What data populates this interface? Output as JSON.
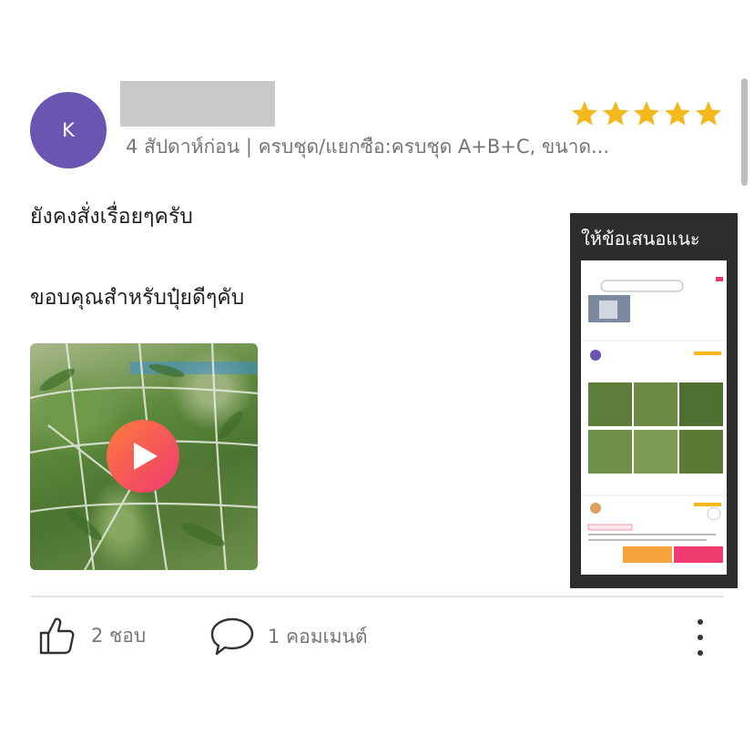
{
  "review": {
    "avatar_initial": "K",
    "rating": 5,
    "meta": "4 สัปดาห์ก่อน | ครบชุด/แยกซือ:ครบชุด A+B+C, ขนาด...",
    "lines": [
      "ยังคงสั่งเรื่อยๆครับ",
      "ขอบคุณสำหรับปุ๋ยดีๆคับ"
    ]
  },
  "suggest": {
    "title": "ให้ข้อเสนอแนะ"
  },
  "actions": {
    "like_label": "2 ชอบ",
    "comment_label": "1 คอมเมนต์"
  },
  "colors": {
    "avatar": "#6a55b3",
    "star": "#f5b81c",
    "accent": "#ee3a6e"
  },
  "icons": [
    "star-icon",
    "play-icon",
    "thumbs-up-icon",
    "comment-icon",
    "more-vertical-icon"
  ]
}
